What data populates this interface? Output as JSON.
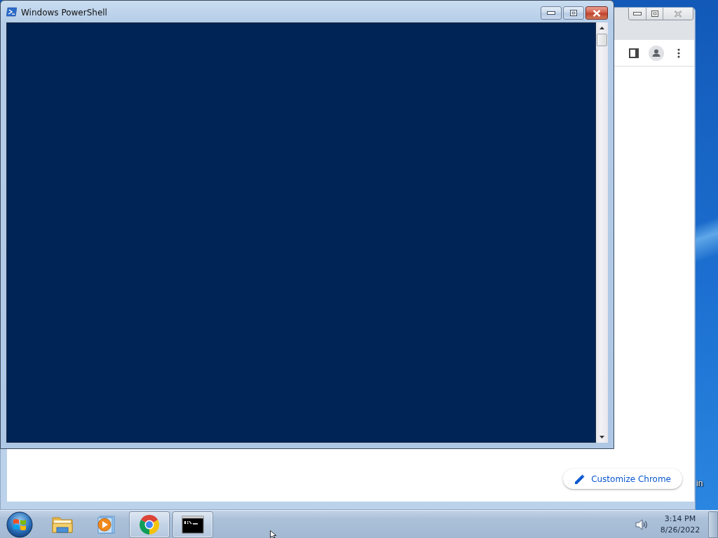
{
  "console_window": {
    "title": "Windows PowerShell"
  },
  "browser_window": {
    "customize_button": {
      "label": "Customize Chrome"
    }
  },
  "desktop_icon": {
    "label": "in"
  },
  "taskbar": {
    "items": [
      {
        "kind": "folder",
        "running": false
      },
      {
        "kind": "media",
        "running": false
      },
      {
        "kind": "browser",
        "running": true
      },
      {
        "kind": "terminal",
        "running": true
      }
    ]
  },
  "clock": {
    "time": "3:14 PM",
    "date": "8/26/2022"
  }
}
